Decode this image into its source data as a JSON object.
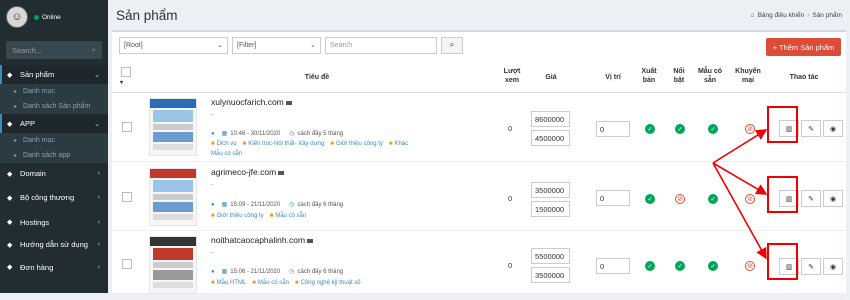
{
  "sidebar": {
    "status": "Online",
    "search_placeholder": "Search...",
    "items": [
      {
        "label": "Sản phẩm",
        "icon": "cube-icon"
      },
      {
        "label": "Danh mục"
      },
      {
        "label": "Danh sách Sản phẩm"
      },
      {
        "label": "APP",
        "icon": "cube-icon"
      },
      {
        "label": "Danh mục"
      },
      {
        "label": "Danh sách app"
      },
      {
        "label": "Domain",
        "icon": "cube-icon"
      },
      {
        "label": "Bộ công thương",
        "icon": "cube-icon"
      },
      {
        "label": "Hostings",
        "icon": "cube-icon"
      },
      {
        "label": "Hướng dẫn sử dụng",
        "icon": "cube-icon"
      },
      {
        "label": "Đơn hàng",
        "icon": "cube-icon"
      }
    ]
  },
  "header": {
    "title": "Sản phẩm",
    "breadcrumb": [
      "Bảng điều khiển",
      "Sản phẩm"
    ]
  },
  "toolbar": {
    "filter1": "[Root]",
    "filter2": "[Filter]",
    "search_placeholder": "Search",
    "add_label": "+ Thêm Sản phẩm"
  },
  "table": {
    "columns": [
      "Tiêu đề",
      "Lượt xem",
      "Giá",
      "Vị trí",
      "Xuất bản",
      "Nổi bật",
      "Mẫu có sẵn",
      "Khuyến mại",
      "Thao tác"
    ],
    "rows": [
      {
        "domain": "xulynuocfarich.com",
        "dash": "-",
        "date": "10:46 - 30/11/2020",
        "ago": "cách đây 5 tháng",
        "categories": [
          "Dịch vụ",
          "Kiến trúc-Nội thất- Xây dựng",
          "Giới thiệu công ty",
          "Khác",
          "Mẫu có sẵn"
        ],
        "views": "0",
        "price1": "8600000",
        "price2": "4500000",
        "position": "0"
      },
      {
        "domain": "agrimeco-jfe.com",
        "dash": "-",
        "date": "15:09 - 21/11/2020",
        "ago": "cách đây 6 tháng",
        "categories": [
          "Giới thiệu công ty",
          "Mẫu có sẵn"
        ],
        "views": "0",
        "price1": "3500000",
        "price2": "1500000",
        "position": "0"
      },
      {
        "domain": "noithatcaocaphalinh.com",
        "dash": "-",
        "date": "15:06 - 21/11/2020",
        "ago": "cách đây 6 tháng",
        "categories": [
          "Mẫu HTML",
          "Mẫu có sẵn",
          "Công nghệ kỹ thuật số"
        ],
        "views": "0",
        "price1": "5500000",
        "price2": "3500000",
        "position": "0"
      }
    ]
  },
  "colors": {
    "sidebar": "#222d32",
    "accent": "#3c8dbc",
    "danger": "#dd4b39",
    "success": "#00a65a",
    "annotation": "#e00000"
  }
}
